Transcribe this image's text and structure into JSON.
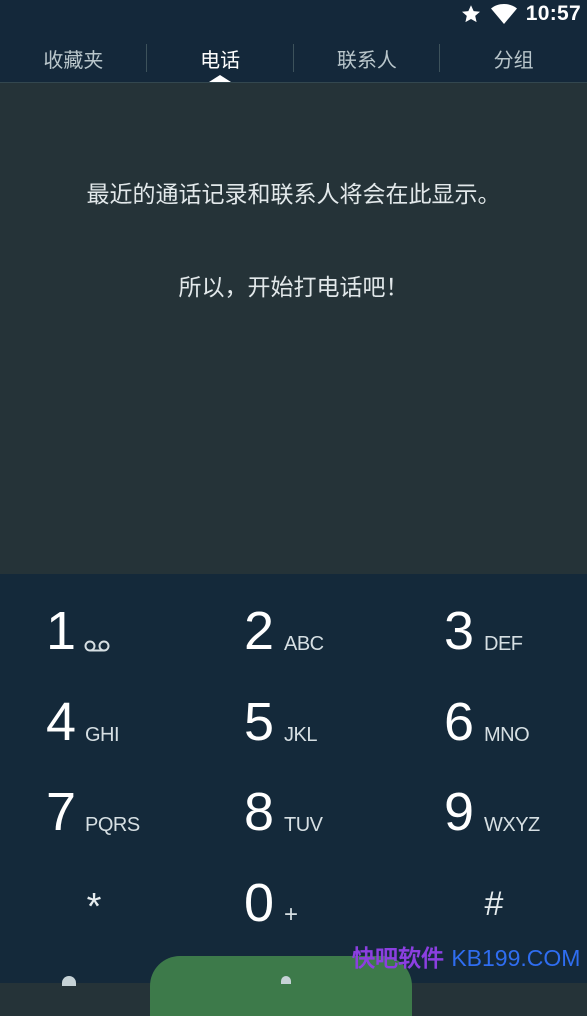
{
  "status_bar": {
    "time": "10:57",
    "icons": [
      "star-icon",
      "wifi-icon"
    ]
  },
  "tabs": [
    {
      "label": "收藏夹",
      "active": false
    },
    {
      "label": "电话",
      "active": true
    },
    {
      "label": "联系人",
      "active": false
    },
    {
      "label": "分组",
      "active": false
    }
  ],
  "empty_state": {
    "message": "最近的通话记录和联系人将会在此显示。",
    "cta": "所以，开始打电话吧！"
  },
  "dialpad": {
    "keys": [
      {
        "digit": "1",
        "letters": "",
        "icon": "voicemail-icon"
      },
      {
        "digit": "2",
        "letters": "ABC"
      },
      {
        "digit": "3",
        "letters": "DEF"
      },
      {
        "digit": "4",
        "letters": "GHI"
      },
      {
        "digit": "5",
        "letters": "JKL"
      },
      {
        "digit": "6",
        "letters": "MNO"
      },
      {
        "digit": "7",
        "letters": "PQRS"
      },
      {
        "digit": "8",
        "letters": "TUV"
      },
      {
        "digit": "9",
        "letters": "WXYZ"
      },
      {
        "digit": "*",
        "letters": ""
      },
      {
        "digit": "0",
        "letters": "+"
      },
      {
        "digit": "#",
        "letters": ""
      }
    ]
  },
  "watermark": {
    "cn": "快吧软件",
    "en": "KB199.COM"
  },
  "colors": {
    "status_bar_bg": "#14283a",
    "content_bg": "#253338",
    "dialpad_bg": "#14293a",
    "call_button": "#3d7a4a",
    "watermark_cn": "#8b3fe0",
    "watermark_en": "#2f6df0"
  }
}
